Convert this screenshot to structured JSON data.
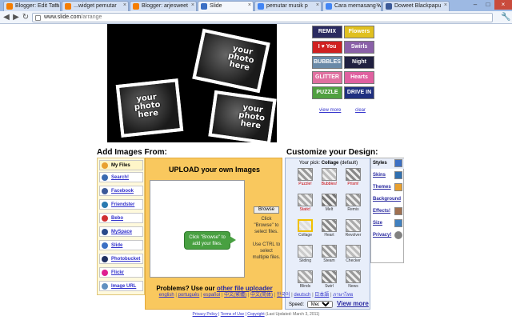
{
  "browser": {
    "tabs": [
      {
        "title": "Blogger: Edit Tata",
        "active": false,
        "icon_color": "#f57d00"
      },
      {
        "title": "...widget pemutar",
        "active": false,
        "icon_color": "#f57d00"
      },
      {
        "title": "Blogger: arjesweet",
        "active": false,
        "icon_color": "#f57d00"
      },
      {
        "title": "Slide",
        "active": true,
        "icon_color": "#3b6fc4"
      },
      {
        "title": "pemutar musik p",
        "active": false,
        "icon_color": "#4285f4"
      },
      {
        "title": "Cara memasang w",
        "active": false,
        "icon_color": "#4285f4"
      },
      {
        "title": "Doweet Blackpapu",
        "active": false,
        "icon_color": "#3b5998"
      }
    ],
    "url_host": "www.slide.com",
    "url_path": "/arrange",
    "back_icon": "back-arrow-icon",
    "forward_icon": "forward-arrow-icon",
    "reload_icon": "reload-icon",
    "wrench_icon": "wrench-icon"
  },
  "hero": {
    "photo_label_line1": "your",
    "photo_label_line2": "photo",
    "photo_label_line3": "here"
  },
  "fonts": {
    "items": [
      {
        "label": "REMIX",
        "color": "#2b2b60"
      },
      {
        "label": "Flowers",
        "color": "#e0c020"
      },
      {
        "label": "I ♥ You",
        "color": "#d02020"
      },
      {
        "label": "Swirls",
        "color": "#8a60a8"
      },
      {
        "label": "BUBBLES",
        "color": "#6a8aa8"
      },
      {
        "label": "Night",
        "color": "#202040"
      },
      {
        "label": "GLITTER",
        "color": "#e070a0"
      },
      {
        "label": "Hearts",
        "color": "#e060a0"
      },
      {
        "label": "PUZZLE",
        "color": "#50a040"
      },
      {
        "label": "DRIVE IN",
        "color": "#203080"
      }
    ],
    "view_more": "view more",
    "clear": "clear"
  },
  "add_images": {
    "heading": "Add Images From:",
    "sources": [
      {
        "label": "My Files",
        "color": "#e8a030"
      },
      {
        "label": "Search!",
        "color": "#3a6ab0"
      },
      {
        "label": "Facebook",
        "color": "#3b5998"
      },
      {
        "label": "Friendster",
        "color": "#2a7ab0"
      },
      {
        "label": "Bebo",
        "color": "#d03030"
      },
      {
        "label": "MySpace",
        "color": "#2a4a8a"
      },
      {
        "label": "Slide",
        "color": "#3b6fc4"
      },
      {
        "label": "Photobucket",
        "color": "#203060"
      },
      {
        "label": "Flickr",
        "color": "#e02090"
      },
      {
        "label": "Image URL",
        "color": "#6090c0"
      }
    ]
  },
  "upload": {
    "title": "UPLOAD your own Images",
    "browse_button": "Browse",
    "help_line1": "Click",
    "help_line2": "\"Browse\" to",
    "help_line3": "select files.",
    "help_line4": "Use CTRL to",
    "help_line5": "select",
    "help_line6": "multiple files.",
    "tooltip_line1": "Click \"Browse\" to",
    "tooltip_line2": "add your files.",
    "problems_text": "Problems? Use our ",
    "problems_link": "other file uploader"
  },
  "customize": {
    "heading": "Customize your Design:",
    "your_pick_label": "Your pick:",
    "your_pick_value": "Collage",
    "your_pick_suffix": "(default)",
    "styles": [
      {
        "name": "Puzzle!",
        "red": true,
        "selected": false
      },
      {
        "name": "Bubbles!",
        "red": true,
        "selected": false
      },
      {
        "name": "Prism!",
        "red": true,
        "selected": false
      },
      {
        "name": "Static!",
        "red": true,
        "selected": false
      },
      {
        "name": "Melt",
        "red": false,
        "selected": false
      },
      {
        "name": "Remix",
        "red": false,
        "selected": false
      },
      {
        "name": "Collage",
        "red": false,
        "selected": true
      },
      {
        "name": "Heart",
        "red": false,
        "selected": false
      },
      {
        "name": "Revolver",
        "red": false,
        "selected": false
      },
      {
        "name": "Sliding",
        "red": false,
        "selected": false
      },
      {
        "name": "Steam",
        "red": false,
        "selected": false
      },
      {
        "name": "Checker",
        "red": false,
        "selected": false
      },
      {
        "name": "Blinds",
        "red": false,
        "selected": false
      },
      {
        "name": "Swirl",
        "red": false,
        "selected": false
      },
      {
        "name": "News",
        "red": false,
        "selected": false
      }
    ],
    "speed_label": "Speed:",
    "speed_value": "Medium",
    "view_more": "View more"
  },
  "categories": [
    {
      "label": "Styles",
      "color": "#3b6fc4"
    },
    {
      "label": "Skins",
      "color": "#3070b0"
    },
    {
      "label": "Themes",
      "color": "#e8a030"
    },
    {
      "label": "Background",
      "color": "#7090c0"
    },
    {
      "label": "Effects!",
      "color": "#a07050"
    },
    {
      "label": "Size",
      "color": "#4080c0"
    },
    {
      "label": "Privacy!",
      "color": "#808080"
    }
  ],
  "footer": {
    "languages": [
      "english",
      "português",
      "español",
      "中文(繁體)",
      "中文(简体)",
      "한국어",
      "deutsch",
      "日本語",
      "ภาษาไทย"
    ],
    "privacy_policy": "Privacy Policy",
    "terms_of_use": "Terms of Use",
    "copyright": "Copyright",
    "last_updated": "(Last Updated: March 3, 2011)"
  }
}
